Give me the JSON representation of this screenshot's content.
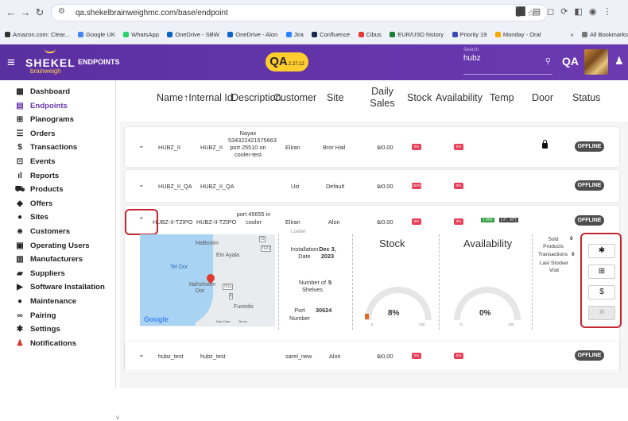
{
  "browser": {
    "url": "qa.shekelbrainweighmc.com/base/endpoint",
    "bookmarks": [
      "Amazon.com: Clear...",
      "Google UK",
      "WhatsApp",
      "OneDrive - SBW",
      "OneDrive - Alon",
      "Jira",
      "Confluence",
      "Cibus",
      "EUR/USD history",
      "Priority 19",
      "Monday - Oral"
    ],
    "bookmarks_more": "»",
    "all_bookmarks": "All Bookmarks"
  },
  "app": {
    "brand": "SHEKEL",
    "brand_sub": "brainweigh",
    "section": "ENDPOINTS",
    "env": "QA",
    "version": "2.27.12",
    "search_label": "Search",
    "search_value": "hubz",
    "user_initials": "QA"
  },
  "sidebar": [
    "Dashboard",
    "Endpoints",
    "Planograms",
    "Orders",
    "Transactions",
    "Events",
    "Reports",
    "Products",
    "Offers",
    "Sites",
    "Customers",
    "Operating Users",
    "Manufacturers",
    "Suppliers",
    "Software Installation",
    "Maintenance",
    "Pairing",
    "Settings",
    "Notifications"
  ],
  "table": {
    "headers": {
      "name": "Name",
      "internal_id": "↑Internal Id",
      "description": "Description",
      "customer": "Customer",
      "site": "Site",
      "daily_sales": "Daily Sales",
      "stock": "Stock",
      "availability": "Availability",
      "temp": "Temp",
      "door": "Door",
      "status": "Status"
    },
    "rows": [
      {
        "name": "HUBZ_II",
        "internal_id": "HUBZ_II",
        "desc1": "Nayax",
        "desc2": "534322421575663",
        "desc3": "port 25510 on",
        "desc4": "cooler-test",
        "customer": "Eliran",
        "site": "Bror Hail",
        "sales": "₪0.00",
        "stock": "0%",
        "availability": "0%",
        "status": "OFFLINE"
      },
      {
        "name": "HUBZ_II_QA",
        "internal_id": "HUBZ_II_QA",
        "customer": "Uzi",
        "site": "Default",
        "sales": "₪0.00",
        "stock": "100%",
        "availability": "0%",
        "status": "OFFLINE"
      },
      {
        "name": "HUBZ-II-TZIPO",
        "internal_id": "HUBZ-II-TZIPO",
        "desc1": "port 45655 in",
        "desc2": "cooler",
        "customer": "Eliran",
        "site": "Alon",
        "sales": "₪0.00",
        "stock": "0%",
        "availability": "0%",
        "temp_badge": "2.900",
        "temp_range": "[-2°, 10°]",
        "status": "OFFLINE"
      },
      {
        "name": "hubz_test",
        "internal_id": "hubz_test",
        "customer": "sarel_new",
        "site": "Alon",
        "sales": "₪0.00",
        "stock": "0%",
        "availability": "0%",
        "status": "OFFLINE"
      }
    ]
  },
  "detail": {
    "map_labels": [
      "HaBonim",
      "Ein Ayala",
      "Tel Dor",
      "Nahsholim",
      "Dor",
      "Fureidis",
      "Google",
      "Map Data",
      "Terms"
    ],
    "road_labels": [
      "70",
      "7022",
      "7011",
      "4"
    ],
    "cut_text": "Loader",
    "install_label": "Installation Date",
    "install_value": "Dec 3, 2023",
    "shelves_label": "Number of Shelves",
    "shelves_value": "5",
    "port_label": "Port Number",
    "port_value": "30624",
    "stock_title": "Stock",
    "stock_value": "8%",
    "availability_title": "Availability",
    "availability_value": "0%",
    "gauge_min": "0",
    "gauge_max": "100",
    "sold_label": "Sold Products",
    "sold_value": "0",
    "trans_label": "Transactions",
    "trans_value": "0",
    "last_label": "Last Stocker Visit"
  }
}
